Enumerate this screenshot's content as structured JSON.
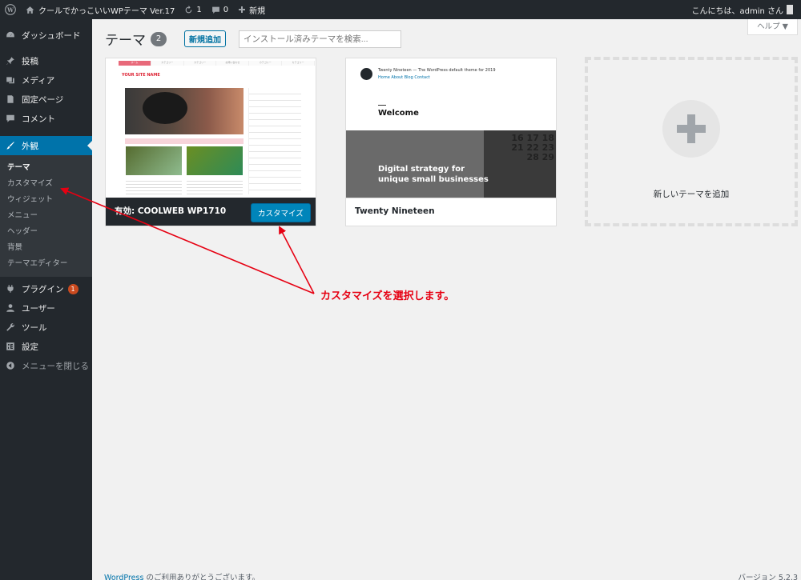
{
  "admin_bar": {
    "site_name": "クールでかっこいいWPテーマ Ver.17",
    "updates_count": "1",
    "comments_count": "0",
    "new_label": "新規",
    "greeting": "こんにちは、admin さん"
  },
  "sidebar": {
    "items": [
      {
        "label": "ダッシュボード",
        "icon": "dashboard-icon"
      },
      {
        "label": "投稿",
        "icon": "pin-icon"
      },
      {
        "label": "メディア",
        "icon": "media-icon"
      },
      {
        "label": "固定ページ",
        "icon": "page-icon"
      },
      {
        "label": "コメント",
        "icon": "comment-icon"
      },
      {
        "label": "外観",
        "icon": "brush-icon"
      }
    ],
    "appearance_submenu": [
      "テーマ",
      "カスタマイズ",
      "ウィジェット",
      "メニュー",
      "ヘッダー",
      "背景",
      "テーマエディター"
    ],
    "lower_items": [
      {
        "label": "プラグイン",
        "icon": "plugin-icon",
        "badge": "1"
      },
      {
        "label": "ユーザー",
        "icon": "user-icon"
      },
      {
        "label": "ツール",
        "icon": "wrench-icon"
      },
      {
        "label": "設定",
        "icon": "settings-icon"
      },
      {
        "label": "メニューを閉じる",
        "icon": "collapse-icon"
      }
    ]
  },
  "page": {
    "title": "テーマ",
    "count": "2",
    "add_new": "新規追加",
    "search_placeholder": "インストール済みテーマを検索...",
    "help": "ヘルプ ▼"
  },
  "themes": {
    "active": {
      "active_label": "有効: COOLWEB WP1710",
      "customize": "カスタマイズ"
    },
    "second": {
      "name": "Twenty Nineteen",
      "screenshot_title": "Twenty Nineteen — The WordPress default theme for 2019",
      "screenshot_nav": "Home  About  Blog  Contact",
      "screenshot_welcome": "Welcome",
      "screenshot_tagline_1": "Digital strategy for",
      "screenshot_tagline_2": "unique small businesses",
      "screenshot_calendar": "16 17 18\n21 22 23\n28 29"
    },
    "add_new_theme": "新しいテーマを追加"
  },
  "theme1_shot": {
    "nav": [
      "ホーム",
      "カテゴリー",
      "カテゴリー",
      "お問い合わせ",
      "カテゴリー",
      "カテゴリー"
    ],
    "logo": "YOUR SITE NAME"
  },
  "annotation": "カスタマイズを選択します。",
  "footer": {
    "link": "WordPress",
    "text": " のご利用ありがとうございます。",
    "version": "バージョン 5.2.3"
  },
  "colors": {
    "admin_dark": "#23282d",
    "accent": "#0073aa",
    "annotation_red": "#e60012"
  }
}
